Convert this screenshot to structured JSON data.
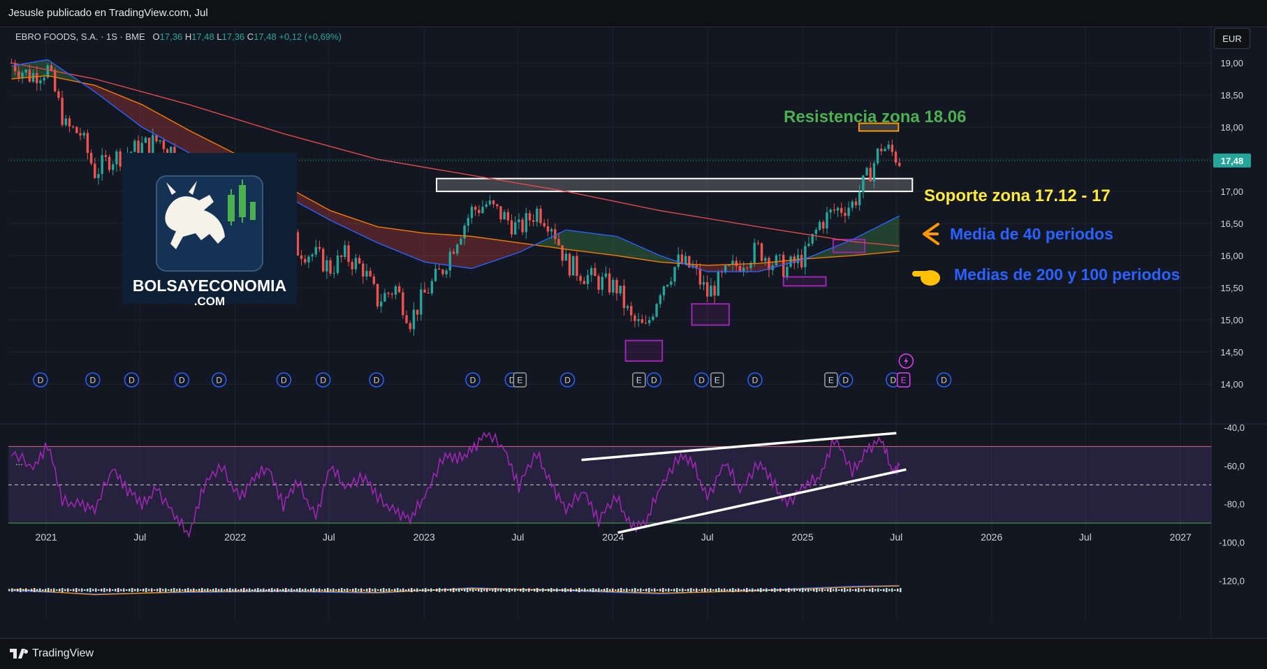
{
  "header": {
    "published_by": "Jesusle publicado en TradingView.com, Jul"
  },
  "footer": {
    "brand": "TradingView"
  },
  "symbol": {
    "name": "EBRO FOODS, S.A. · 1S · BME",
    "open_label": "O",
    "open": "17,36",
    "high_label": "H",
    "high": "17,48",
    "low_label": "L",
    "low": "17,36",
    "close_label": "C",
    "close": "17,48",
    "change": "+0,12 (+0,69%)"
  },
  "currency": "EUR",
  "last_price_tag": "17,48",
  "indicator_menu": "...",
  "logo": {
    "line1": "BOLSAYECONOMIA",
    "line2": ".COM"
  },
  "annotations": {
    "resistance": "Resistencia zona 18.06",
    "support": "Soporte zona 17.12 - 17",
    "ma40": "Media de 40 periodos",
    "ma200_100": "Medias de 200 y 100 periodos"
  },
  "colors": {
    "background": "#131722",
    "up": "#26a69a",
    "down": "#ef5350",
    "ma40": "#2962ff",
    "ma100": "#f57c00",
    "ma200": "#e04a4a",
    "rsi": "#9c27b0",
    "resistance_text": "#4caf50",
    "support_text": "#ffeb3b",
    "annotation_blue": "#2962ff"
  },
  "event_markers": [
    {
      "label": "D",
      "date": "2020-12-21"
    },
    {
      "label": "D",
      "date": "2021-04-01"
    },
    {
      "label": "D",
      "date": "2021-06-15"
    },
    {
      "label": "D",
      "date": "2021-09-20"
    },
    {
      "label": "D",
      "date": "2021-12-01"
    },
    {
      "label": "D",
      "date": "2022-04-05"
    },
    {
      "label": "D",
      "date": "2022-06-20"
    },
    {
      "label": "D",
      "date": "2022-10-01"
    },
    {
      "label": "D",
      "date": "2023-04-05"
    },
    {
      "label": "D",
      "date": "2023-06-20"
    },
    {
      "label": "E",
      "date": "2023-07-05"
    },
    {
      "label": "D",
      "date": "2023-10-05"
    },
    {
      "label": "E",
      "date": "2024-02-20"
    },
    {
      "label": "D",
      "date": "2024-03-20"
    },
    {
      "label": "D",
      "date": "2024-06-20"
    },
    {
      "label": "E",
      "date": "2024-07-20"
    },
    {
      "label": "D",
      "date": "2024-10-01"
    },
    {
      "label": "E",
      "date": "2025-02-25"
    },
    {
      "label": "D",
      "date": "2025-03-25"
    },
    {
      "label": "D",
      "date": "2025-06-25"
    },
    {
      "label": "E",
      "date": "2025-07-15"
    },
    {
      "label": "D",
      "date": "2025-10-01"
    }
  ],
  "chart_data": [
    {
      "type": "line",
      "title": "EBRO FOODS, S.A. · 1S · BME",
      "xlabel": "",
      "ylabel": "",
      "x_ticks": [
        "2021",
        "Jul",
        "2022",
        "Jul",
        "2023",
        "Jul",
        "2024",
        "Jul",
        "2025",
        "Jul",
        "2026",
        "Jul",
        "2027"
      ],
      "y_ticks": [
        "19,00",
        "18,50",
        "18,00",
        "17,50",
        "17,00",
        "16,50",
        "16,00",
        "15,50",
        "15,00",
        "14,50",
        "14,00"
      ],
      "ylim": [
        13.85,
        19.5
      ],
      "x_start": "2020-10-20",
      "x_end": "2027-03-01",
      "grid": true,
      "series": [
        {
          "key": "price",
          "values": [
            [
              "2020-10-26",
              19.0
            ],
            [
              "2020-11-30",
              18.8
            ],
            [
              "2021-01-04",
              18.9
            ],
            [
              "2021-02-08",
              18.0
            ],
            [
              "2021-03-08",
              17.9
            ],
            [
              "2021-04-05",
              17.3
            ],
            [
              "2021-05-03",
              17.5
            ],
            [
              "2021-06-07",
              17.6
            ],
            [
              "2021-07-05",
              17.7
            ],
            [
              "2021-08-09",
              17.8
            ],
            [
              "2021-09-06",
              17.6
            ],
            [
              "2021-10-04",
              17.2
            ],
            [
              "2021-11-01",
              17.3
            ],
            [
              "2021-12-06",
              17.0
            ],
            [
              "2022-01-10",
              16.9
            ],
            [
              "2022-02-07",
              16.7
            ],
            [
              "2022-03-07",
              16.3
            ],
            [
              "2022-04-04",
              16.6
            ],
            [
              "2022-05-02",
              16.1
            ],
            [
              "2022-06-06",
              16.0
            ],
            [
              "2022-07-04",
              15.8
            ],
            [
              "2022-08-01",
              16.0
            ],
            [
              "2022-09-05",
              15.8
            ],
            [
              "2022-10-03",
              15.3
            ],
            [
              "2022-11-07",
              15.5
            ],
            [
              "2022-12-05",
              15.0
            ],
            [
              "2023-01-02",
              15.4
            ],
            [
              "2023-02-06",
              15.8
            ],
            [
              "2023-03-06",
              16.3
            ],
            [
              "2023-04-03",
              16.7
            ],
            [
              "2023-05-01",
              16.8
            ],
            [
              "2023-06-05",
              16.6
            ],
            [
              "2023-07-03",
              16.4
            ],
            [
              "2023-08-07",
              16.7
            ],
            [
              "2023-09-04",
              16.5
            ],
            [
              "2023-10-02",
              15.9
            ],
            [
              "2023-11-06",
              15.7
            ],
            [
              "2023-12-04",
              15.6
            ],
            [
              "2024-01-08",
              15.5
            ],
            [
              "2024-02-05",
              15.0
            ],
            [
              "2024-03-04",
              14.85
            ],
            [
              "2024-04-01",
              15.5
            ],
            [
              "2024-05-06",
              15.9
            ],
            [
              "2024-06-03",
              15.8
            ],
            [
              "2024-07-01",
              15.4
            ],
            [
              "2024-08-05",
              15.7
            ],
            [
              "2024-09-02",
              15.9
            ],
            [
              "2024-10-07",
              16.1
            ],
            [
              "2024-11-04",
              15.9
            ],
            [
              "2024-12-02",
              15.8
            ],
            [
              "2025-01-06",
              16.0
            ],
            [
              "2025-02-03",
              16.5
            ],
            [
              "2025-03-03",
              16.7
            ],
            [
              "2025-04-07",
              16.8
            ],
            [
              "2025-05-05",
              17.2
            ],
            [
              "2025-06-02",
              17.7
            ],
            [
              "2025-06-23",
              17.6
            ],
            [
              "2025-07-07",
              17.48
            ]
          ]
        },
        {
          "key": "ma40",
          "name": "Media de 40 periodos",
          "values": [
            [
              "2020-10-26",
              18.95
            ],
            [
              "2021-01-04",
              19.05
            ],
            [
              "2021-04-05",
              18.55
            ],
            [
              "2021-07-05",
              18.0
            ],
            [
              "2021-10-04",
              17.6
            ],
            [
              "2022-01-10",
              17.3
            ],
            [
              "2022-04-04",
              16.95
            ],
            [
              "2022-07-04",
              16.55
            ],
            [
              "2022-10-03",
              16.2
            ],
            [
              "2023-01-02",
              15.9
            ],
            [
              "2023-04-03",
              15.8
            ],
            [
              "2023-07-03",
              16.05
            ],
            [
              "2023-10-02",
              16.4
            ],
            [
              "2024-01-08",
              16.3
            ],
            [
              "2024-04-01",
              16.0
            ],
            [
              "2024-07-01",
              15.75
            ],
            [
              "2024-10-07",
              15.75
            ],
            [
              "2025-01-06",
              15.95
            ],
            [
              "2025-04-07",
              16.25
            ],
            [
              "2025-07-07",
              16.62
            ]
          ]
        },
        {
          "key": "ma100",
          "name": "Media de 100 periodos",
          "values": [
            [
              "2020-10-26",
              18.75
            ],
            [
              "2021-01-04",
              18.8
            ],
            [
              "2021-04-05",
              18.65
            ],
            [
              "2021-07-05",
              18.35
            ],
            [
              "2021-10-04",
              17.95
            ],
            [
              "2022-01-10",
              17.55
            ],
            [
              "2022-04-04",
              17.1
            ],
            [
              "2022-07-04",
              16.7
            ],
            [
              "2022-10-03",
              16.45
            ],
            [
              "2023-01-02",
              16.35
            ],
            [
              "2023-04-03",
              16.3
            ],
            [
              "2023-07-03",
              16.2
            ],
            [
              "2023-10-02",
              16.1
            ],
            [
              "2024-01-08",
              16.0
            ],
            [
              "2024-04-01",
              15.9
            ],
            [
              "2024-07-01",
              15.85
            ],
            [
              "2024-10-07",
              15.88
            ],
            [
              "2025-01-06",
              15.95
            ],
            [
              "2025-04-07",
              16.0
            ],
            [
              "2025-07-07",
              16.07
            ]
          ]
        },
        {
          "key": "ma200",
          "name": "Media de 200 periodos",
          "values": [
            [
              "2020-10-26",
              19.0
            ],
            [
              "2021-04-05",
              18.75
            ],
            [
              "2021-10-04",
              18.35
            ],
            [
              "2022-04-04",
              17.9
            ],
            [
              "2022-10-03",
              17.5
            ],
            [
              "2023-04-03",
              17.25
            ],
            [
              "2023-10-02",
              17.0
            ],
            [
              "2024-04-01",
              16.7
            ],
            [
              "2024-10-07",
              16.45
            ],
            [
              "2025-04-07",
              16.22
            ],
            [
              "2025-07-07",
              16.15
            ]
          ]
        }
      ],
      "annotations": [
        {
          "kind": "zone",
          "label": "Resistencia zona 18.06",
          "x0": "2025-04-20",
          "x1": "2025-07-05",
          "y0": 17.94,
          "y1": 18.06
        },
        {
          "kind": "zone",
          "label": "Soporte zona 17.12 - 17",
          "x0": "2023-01-25",
          "x1": "2025-08-01",
          "y0": 17.0,
          "y1": 17.2
        },
        {
          "kind": "box",
          "x0": "2024-01-25",
          "x1": "2024-04-05",
          "y0": 14.36,
          "y1": 14.68
        },
        {
          "kind": "box",
          "x0": "2024-06-01",
          "x1": "2024-08-12",
          "y0": 14.92,
          "y1": 15.25
        },
        {
          "kind": "box",
          "x0": "2024-11-25",
          "x1": "2025-02-15",
          "y0": 15.53,
          "y1": 15.67
        },
        {
          "kind": "box",
          "x0": "2025-03-01",
          "x1": "2025-05-01",
          "y0": 16.05,
          "y1": 16.25
        }
      ]
    },
    {
      "type": "line",
      "title": "",
      "xlabel": "",
      "ylabel": "",
      "y_ticks": [
        "-40,0",
        "-60,0",
        "-80,0",
        "-100,0",
        "-120,0"
      ],
      "ylim": [
        -125,
        -40
      ],
      "band": [
        -90,
        -50
      ],
      "midline": -70,
      "series": [
        {
          "key": "rsi",
          "values": [
            [
              "2020-10-26",
              -55
            ],
            [
              "2020-12-07",
              -60
            ],
            [
              "2021-01-04",
              -48
            ],
            [
              "2021-02-01",
              -80
            ],
            [
              "2021-03-08",
              -78
            ],
            [
              "2021-04-05",
              -85
            ],
            [
              "2021-05-10",
              -60
            ],
            [
              "2021-06-07",
              -72
            ],
            [
              "2021-07-05",
              -82
            ],
            [
              "2021-08-02",
              -70
            ],
            [
              "2021-09-06",
              -88
            ],
            [
              "2021-10-04",
              -95
            ],
            [
              "2021-11-01",
              -70
            ],
            [
              "2021-12-06",
              -62
            ],
            [
              "2022-01-10",
              -75
            ],
            [
              "2022-02-07",
              -68
            ],
            [
              "2022-03-07",
              -60
            ],
            [
              "2022-04-04",
              -80
            ],
            [
              "2022-05-02",
              -70
            ],
            [
              "2022-06-06",
              -85
            ],
            [
              "2022-07-04",
              -62
            ],
            [
              "2022-08-01",
              -70
            ],
            [
              "2022-09-05",
              -65
            ],
            [
              "2022-10-03",
              -78
            ],
            [
              "2022-11-07",
              -82
            ],
            [
              "2022-12-05",
              -90
            ],
            [
              "2023-01-02",
              -75
            ],
            [
              "2023-02-06",
              -55
            ],
            [
              "2023-03-06",
              -58
            ],
            [
              "2023-04-03",
              -50
            ],
            [
              "2023-05-01",
              -45
            ],
            [
              "2023-06-05",
              -50
            ],
            [
              "2023-07-03",
              -70
            ],
            [
              "2023-08-07",
              -55
            ],
            [
              "2023-09-04",
              -68
            ],
            [
              "2023-10-02",
              -85
            ],
            [
              "2023-11-06",
              -72
            ],
            [
              "2023-12-04",
              -88
            ],
            [
              "2024-01-08",
              -78
            ],
            [
              "2024-02-05",
              -90
            ],
            [
              "2024-03-04",
              -92
            ],
            [
              "2024-04-01",
              -70
            ],
            [
              "2024-05-06",
              -55
            ],
            [
              "2024-06-03",
              -60
            ],
            [
              "2024-07-01",
              -75
            ],
            [
              "2024-08-05",
              -60
            ],
            [
              "2024-09-02",
              -72
            ],
            [
              "2024-10-07",
              -58
            ],
            [
              "2024-11-04",
              -70
            ],
            [
              "2024-12-02",
              -78
            ],
            [
              "2025-01-06",
              -72
            ],
            [
              "2025-02-03",
              -65
            ],
            [
              "2025-03-03",
              -45
            ],
            [
              "2025-04-07",
              -65
            ],
            [
              "2025-05-05",
              -50
            ],
            [
              "2025-06-02",
              -48
            ],
            [
              "2025-06-23",
              -62
            ],
            [
              "2025-07-07",
              -60
            ]
          ]
        }
      ],
      "trendlines": [
        {
          "x0": "2023-11-01",
          "y0": -57,
          "x1": "2025-07-01",
          "y1": -43
        },
        {
          "x0": "2024-01-10",
          "y0": -95,
          "x1": "2025-07-20",
          "y1": -62
        }
      ]
    },
    {
      "type": "line",
      "title": "",
      "xlabel": "",
      "ylabel": "",
      "series": [
        {
          "key": "macd",
          "values": [
            [
              "2020-10-26",
              -120.5
            ],
            [
              "2021-04-05",
              -122.5
            ],
            [
              "2021-10-04",
              -121.5
            ],
            [
              "2022-04-04",
              -121.0
            ],
            [
              "2022-10-03",
              -122.0
            ],
            [
              "2023-04-03",
              -118.5
            ],
            [
              "2023-10-02",
              -120.5
            ],
            [
              "2024-04-01",
              -122.5
            ],
            [
              "2024-10-07",
              -120.0
            ],
            [
              "2025-04-07",
              -117.5
            ],
            [
              "2025-07-07",
              -117.0
            ]
          ]
        },
        {
          "key": "signal",
          "values": [
            [
              "2020-10-26",
              -119.5
            ],
            [
              "2021-04-05",
              -123.0
            ],
            [
              "2021-10-04",
              -121.0
            ],
            [
              "2022-04-04",
              -120.5
            ],
            [
              "2022-10-03",
              -121.5
            ],
            [
              "2023-04-03",
              -119.0
            ],
            [
              "2023-10-02",
              -120.0
            ],
            [
              "2024-04-01",
              -122.0
            ],
            [
              "2024-10-07",
              -120.5
            ],
            [
              "2025-04-07",
              -118.0
            ],
            [
              "2025-07-07",
              -117.3
            ]
          ]
        }
      ]
    }
  ]
}
